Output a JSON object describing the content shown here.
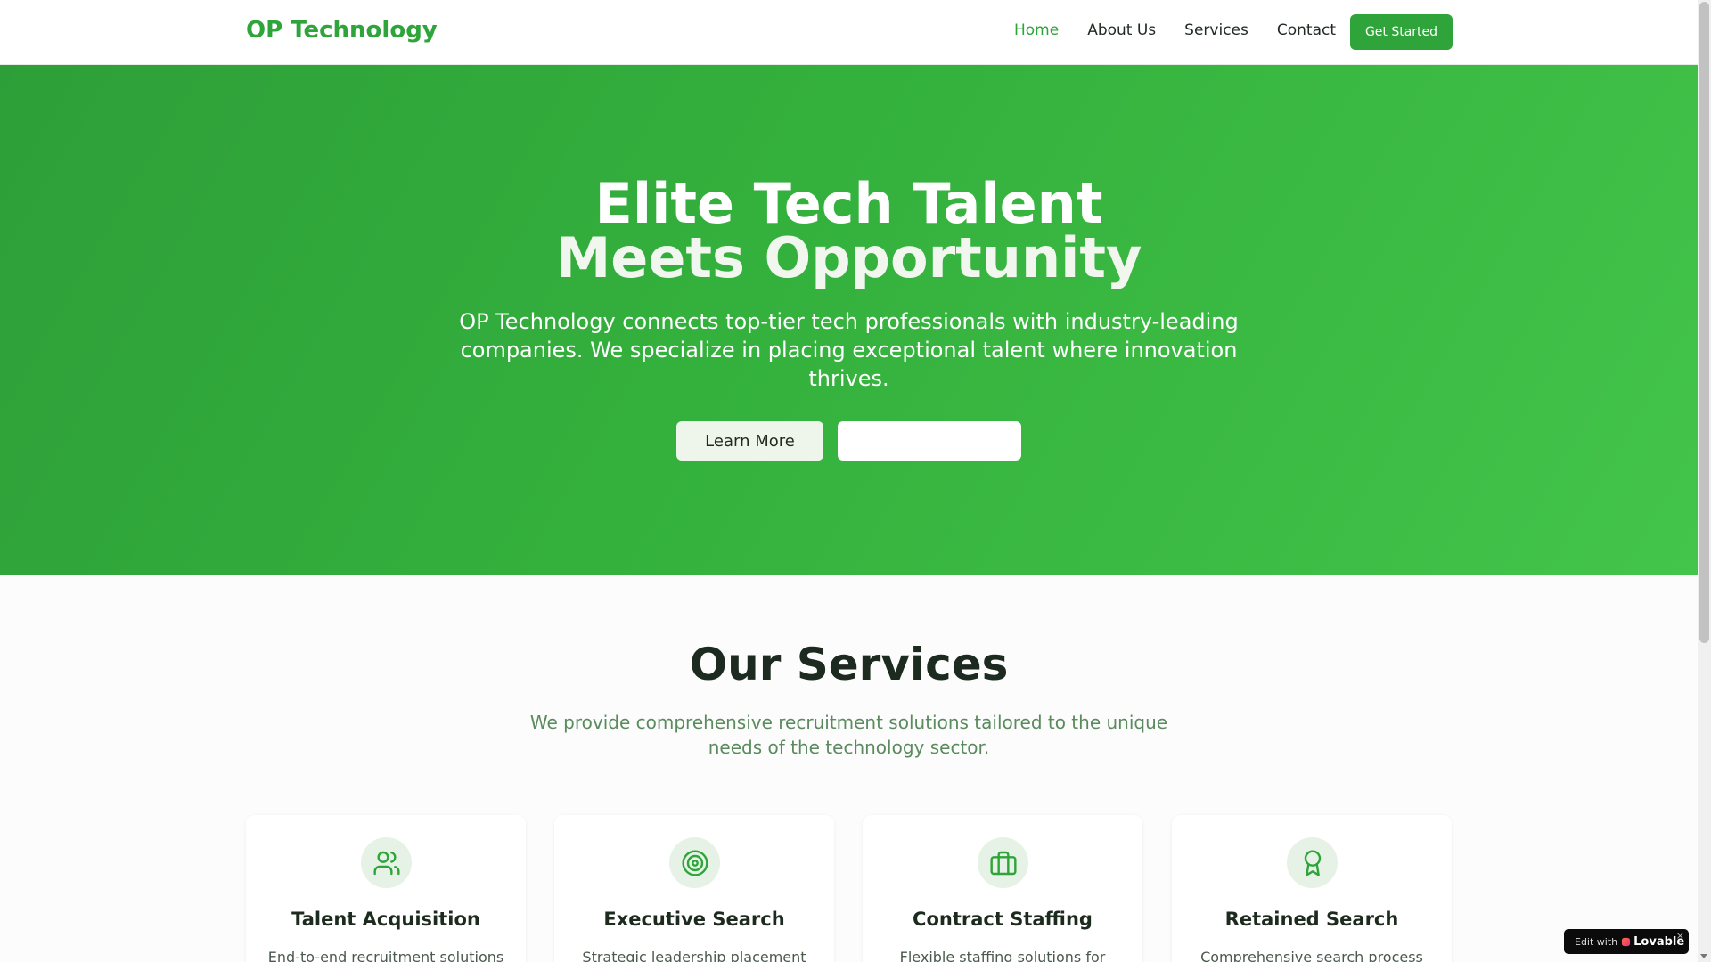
{
  "nav": {
    "brand": "OP Technology",
    "links": [
      {
        "label": "Home",
        "active": true
      },
      {
        "label": "About Us",
        "active": false
      },
      {
        "label": "Services",
        "active": false
      },
      {
        "label": "Contact",
        "active": false
      }
    ],
    "cta_label": "Get Started"
  },
  "hero": {
    "title_line1": "Elite Tech Talent",
    "title_line2": "Meets Opportunity",
    "subtitle": "OP Technology connects top-tier tech professionals with industry-leading companies. We specialize in placing exceptional talent where innovation thrives.",
    "primary_button": "Learn More",
    "secondary_button": ""
  },
  "services": {
    "title": "Our Services",
    "subtitle": "We provide comprehensive recruitment solutions tailored to the unique needs of the technology sector.",
    "cards": [
      {
        "title": "Talent Acquisition",
        "description": "End-to-end recruitment solutions",
        "icon": "users-icon"
      },
      {
        "title": "Executive Search",
        "description": "Strategic leadership placement",
        "icon": "target-icon"
      },
      {
        "title": "Contract Staffing",
        "description": "Flexible staffing solutions for",
        "icon": "briefcase-icon"
      },
      {
        "title": "Retained Search",
        "description": "Comprehensive search process",
        "icon": "award-icon"
      }
    ]
  },
  "badge": {
    "prefix": "Edit with",
    "name": "Lovable",
    "close": "×"
  },
  "colors": {
    "brand_green": "#2ea43a",
    "hero_gradient_start": "#2e9f38",
    "hero_gradient_end": "#43c44a",
    "icon_bg": "#e5f2e5",
    "subtitle_green": "#5a8a5e"
  }
}
